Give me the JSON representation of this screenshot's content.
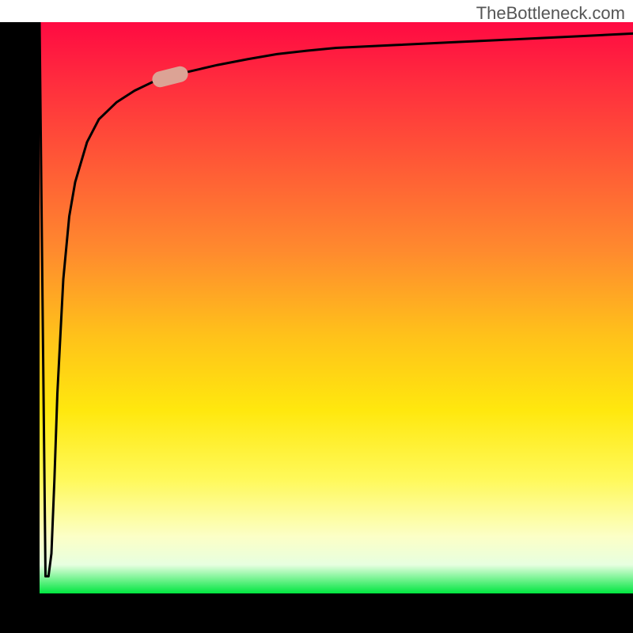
{
  "attribution": "TheBottleneck.com",
  "chart_data": {
    "type": "line",
    "title": "",
    "xlabel": "",
    "ylabel": "",
    "xlim": [
      0,
      1
    ],
    "ylim": [
      0,
      1
    ],
    "grid": false,
    "legend": false,
    "x": [
      0.0,
      0.01,
      0.015,
      0.02,
      0.025,
      0.03,
      0.04,
      0.05,
      0.06,
      0.08,
      0.1,
      0.13,
      0.16,
      0.19,
      0.22,
      0.25,
      0.3,
      0.35,
      0.4,
      0.45,
      0.5,
      0.6,
      0.7,
      0.8,
      0.9,
      1.0
    ],
    "values": [
      1.0,
      0.03,
      0.03,
      0.07,
      0.2,
      0.35,
      0.55,
      0.66,
      0.72,
      0.79,
      0.83,
      0.86,
      0.88,
      0.895,
      0.905,
      0.913,
      0.925,
      0.935,
      0.944,
      0.95,
      0.955,
      0.96,
      0.965,
      0.97,
      0.975,
      0.98
    ],
    "marker": {
      "x": 0.22,
      "y": 0.905
    }
  },
  "colors": {
    "top": "#ff0a42",
    "mid": "#ffe80e",
    "bottom": "#00e640",
    "axis": "#000000",
    "marker": "#dca395"
  }
}
